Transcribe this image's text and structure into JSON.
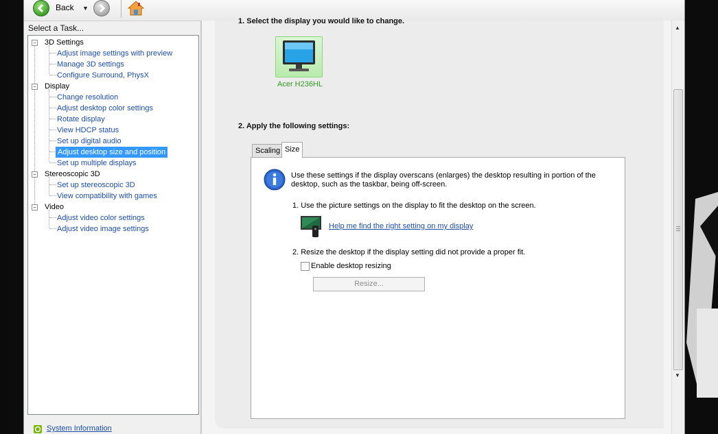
{
  "toolbar": {
    "back_label": "Back"
  },
  "sidebar": {
    "header": "Select a Task...",
    "categories": [
      {
        "label": "3D Settings",
        "items": [
          "Adjust image settings with preview",
          "Manage 3D settings",
          "Configure Surround, PhysX"
        ]
      },
      {
        "label": "Display",
        "items": [
          "Change resolution",
          "Adjust desktop color settings",
          "Rotate display",
          "View HDCP status",
          "Set up digital audio",
          "Adjust desktop size and position",
          "Set up multiple displays"
        ]
      },
      {
        "label": "Stereoscopic 3D",
        "items": [
          "Set up stereoscopic 3D",
          "View compatibility with games"
        ]
      },
      {
        "label": "Video",
        "items": [
          "Adjust video color settings",
          "Adjust video image settings"
        ]
      }
    ],
    "selected_item": "Adjust desktop size and position",
    "system_info_link": "System Information"
  },
  "main": {
    "step1_title": "1. Select the display you would like to change.",
    "display_name": "Acer H236HL",
    "step2_title": "2. Apply the following settings:",
    "tabs": [
      {
        "label": "Scaling",
        "active": false
      },
      {
        "label": "Size",
        "active": true
      }
    ],
    "size_tab": {
      "info_text": "Use these settings if the display overscans (enlarges) the desktop resulting in portion of the desktop, such as the taskbar, being off-screen.",
      "sub1": "1. Use the picture settings on the display to fit the desktop on the screen.",
      "help_link": "Help me find the right setting on my display",
      "sub2": "2. Resize the desktop if the display setting did not provide a proper fit.",
      "checkbox_label": "Enable desktop resizing",
      "checkbox_checked": false,
      "resize_button": "Resize..."
    }
  },
  "colors": {
    "link": "#1c4ea8",
    "selection": "#3399ff",
    "display_tile": "#c8f0bd",
    "display_label": "#2f9a1f"
  }
}
